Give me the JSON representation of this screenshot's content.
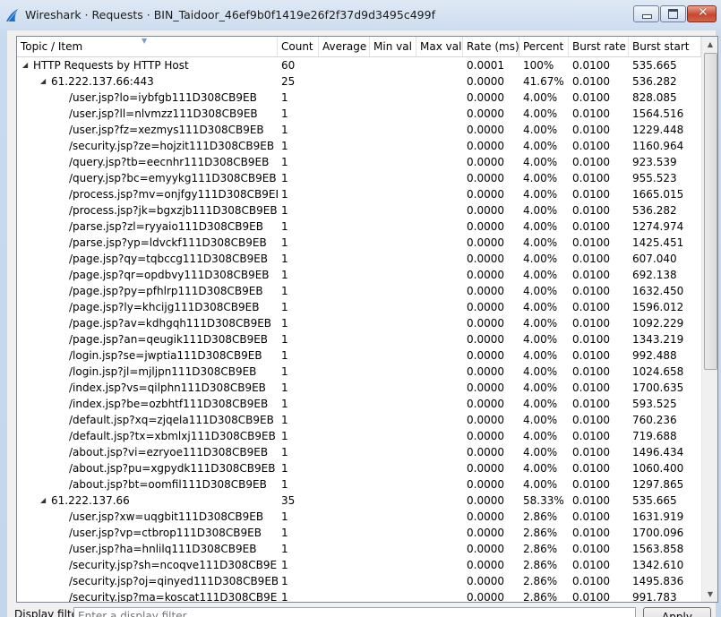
{
  "window": {
    "title": "Wireshark · Requests · BIN_Taidoor_46ef9b0f1419e26f2f37d9d3495c499f",
    "icon": "wireshark-fin-icon",
    "accent": "#1e6fc8"
  },
  "columns": [
    "Topic / Item",
    "Count",
    "Average",
    "Min val",
    "Max val",
    "Rate (ms)",
    "Percent",
    "Burst rate",
    "Burst start"
  ],
  "rows": [
    {
      "level": 0,
      "expanded": true,
      "topic": "HTTP Requests by HTTP Host",
      "count": "60",
      "rate": "0.0001",
      "percent": "100%",
      "burst_rate": "0.0100",
      "burst_start": "535.665"
    },
    {
      "level": 1,
      "expanded": true,
      "topic": "61.222.137.66:443",
      "count": "25",
      "rate": "0.0000",
      "percent": "41.67%",
      "burst_rate": "0.0100",
      "burst_start": "536.282"
    },
    {
      "level": 2,
      "topic": "/user.jsp?lo=iybfgb111D308CB9EB",
      "count": "1",
      "rate": "0.0000",
      "percent": "4.00%",
      "burst_rate": "0.0100",
      "burst_start": "828.085"
    },
    {
      "level": 2,
      "topic": "/user.jsp?ll=nlvmzz111D308CB9EB",
      "count": "1",
      "rate": "0.0000",
      "percent": "4.00%",
      "burst_rate": "0.0100",
      "burst_start": "1564.516"
    },
    {
      "level": 2,
      "topic": "/user.jsp?fz=xezmys111D308CB9EB",
      "count": "1",
      "rate": "0.0000",
      "percent": "4.00%",
      "burst_rate": "0.0100",
      "burst_start": "1229.448"
    },
    {
      "level": 2,
      "topic": "/security.jsp?ze=hojzit111D308CB9EB",
      "count": "1",
      "rate": "0.0000",
      "percent": "4.00%",
      "burst_rate": "0.0100",
      "burst_start": "1160.964"
    },
    {
      "level": 2,
      "topic": "/query.jsp?tb=eecnhr111D308CB9EB",
      "count": "1",
      "rate": "0.0000",
      "percent": "4.00%",
      "burst_rate": "0.0100",
      "burst_start": "923.539"
    },
    {
      "level": 2,
      "topic": "/query.jsp?bc=emyykg111D308CB9EB",
      "count": "1",
      "rate": "0.0000",
      "percent": "4.00%",
      "burst_rate": "0.0100",
      "burst_start": "955.523"
    },
    {
      "level": 2,
      "topic": "/process.jsp?mv=onjfgy111D308CB9EB",
      "count": "1",
      "rate": "0.0000",
      "percent": "4.00%",
      "burst_rate": "0.0100",
      "burst_start": "1665.015"
    },
    {
      "level": 2,
      "topic": "/process.jsp?jk=bgxzjb111D308CB9EB",
      "count": "1",
      "rate": "0.0000",
      "percent": "4.00%",
      "burst_rate": "0.0100",
      "burst_start": "536.282"
    },
    {
      "level": 2,
      "topic": "/parse.jsp?zl=ryyaio111D308CB9EB",
      "count": "1",
      "rate": "0.0000",
      "percent": "4.00%",
      "burst_rate": "0.0100",
      "burst_start": "1274.974"
    },
    {
      "level": 2,
      "topic": "/parse.jsp?yp=ldvckf111D308CB9EB",
      "count": "1",
      "rate": "0.0000",
      "percent": "4.00%",
      "burst_rate": "0.0100",
      "burst_start": "1425.451"
    },
    {
      "level": 2,
      "topic": "/page.jsp?qy=tqbccg111D308CB9EB",
      "count": "1",
      "rate": "0.0000",
      "percent": "4.00%",
      "burst_rate": "0.0100",
      "burst_start": "607.040"
    },
    {
      "level": 2,
      "topic": "/page.jsp?qr=opdbvy111D308CB9EB",
      "count": "1",
      "rate": "0.0000",
      "percent": "4.00%",
      "burst_rate": "0.0100",
      "burst_start": "692.138"
    },
    {
      "level": 2,
      "topic": "/page.jsp?py=pfhlrp111D308CB9EB",
      "count": "1",
      "rate": "0.0000",
      "percent": "4.00%",
      "burst_rate": "0.0100",
      "burst_start": "1632.450"
    },
    {
      "level": 2,
      "topic": "/page.jsp?ly=khcijg111D308CB9EB",
      "count": "1",
      "rate": "0.0000",
      "percent": "4.00%",
      "burst_rate": "0.0100",
      "burst_start": "1596.012"
    },
    {
      "level": 2,
      "topic": "/page.jsp?av=kdhgqh111D308CB9EB",
      "count": "1",
      "rate": "0.0000",
      "percent": "4.00%",
      "burst_rate": "0.0100",
      "burst_start": "1092.229"
    },
    {
      "level": 2,
      "topic": "/page.jsp?an=qeugik111D308CB9EB",
      "count": "1",
      "rate": "0.0000",
      "percent": "4.00%",
      "burst_rate": "0.0100",
      "burst_start": "1343.219"
    },
    {
      "level": 2,
      "topic": "/login.jsp?se=jwptia111D308CB9EB",
      "count": "1",
      "rate": "0.0000",
      "percent": "4.00%",
      "burst_rate": "0.0100",
      "burst_start": "992.488"
    },
    {
      "level": 2,
      "topic": "/login.jsp?jl=mjljpn111D308CB9EB",
      "count": "1",
      "rate": "0.0000",
      "percent": "4.00%",
      "burst_rate": "0.0100",
      "burst_start": "1024.658"
    },
    {
      "level": 2,
      "topic": "/index.jsp?vs=qilphn111D308CB9EB",
      "count": "1",
      "rate": "0.0000",
      "percent": "4.00%",
      "burst_rate": "0.0100",
      "burst_start": "1700.635"
    },
    {
      "level": 2,
      "topic": "/index.jsp?be=ozbhtf111D308CB9EB",
      "count": "1",
      "rate": "0.0000",
      "percent": "4.00%",
      "burst_rate": "0.0100",
      "burst_start": "593.525"
    },
    {
      "level": 2,
      "topic": "/default.jsp?xq=zjqela111D308CB9EB",
      "count": "1",
      "rate": "0.0000",
      "percent": "4.00%",
      "burst_rate": "0.0100",
      "burst_start": "760.236"
    },
    {
      "level": 2,
      "topic": "/default.jsp?tx=xbmlxj111D308CB9EB",
      "count": "1",
      "rate": "0.0000",
      "percent": "4.00%",
      "burst_rate": "0.0100",
      "burst_start": "719.688"
    },
    {
      "level": 2,
      "topic": "/about.jsp?vi=ezryoe111D308CB9EB",
      "count": "1",
      "rate": "0.0000",
      "percent": "4.00%",
      "burst_rate": "0.0100",
      "burst_start": "1496.434"
    },
    {
      "level": 2,
      "topic": "/about.jsp?pu=xgpydk111D308CB9EB",
      "count": "1",
      "rate": "0.0000",
      "percent": "4.00%",
      "burst_rate": "0.0100",
      "burst_start": "1060.400"
    },
    {
      "level": 2,
      "topic": "/about.jsp?bt=oomfil111D308CB9EB",
      "count": "1",
      "rate": "0.0000",
      "percent": "4.00%",
      "burst_rate": "0.0100",
      "burst_start": "1297.865"
    },
    {
      "level": 1,
      "expanded": true,
      "topic": "61.222.137.66",
      "count": "35",
      "rate": "0.0000",
      "percent": "58.33%",
      "burst_rate": "0.0100",
      "burst_start": "535.665"
    },
    {
      "level": 2,
      "topic": "/user.jsp?xw=uqgbit111D308CB9EB",
      "count": "1",
      "rate": "0.0000",
      "percent": "2.86%",
      "burst_rate": "0.0100",
      "burst_start": "1631.919"
    },
    {
      "level": 2,
      "topic": "/user.jsp?vp=ctbrop111D308CB9EB",
      "count": "1",
      "rate": "0.0000",
      "percent": "2.86%",
      "burst_rate": "0.0100",
      "burst_start": "1700.096"
    },
    {
      "level": 2,
      "topic": "/user.jsp?ha=hnlilq111D308CB9EB",
      "count": "1",
      "rate": "0.0000",
      "percent": "2.86%",
      "burst_rate": "0.0100",
      "burst_start": "1563.858"
    },
    {
      "level": 2,
      "topic": "/security.jsp?sh=ncoqve111D308CB9EB",
      "count": "1",
      "rate": "0.0000",
      "percent": "2.86%",
      "burst_rate": "0.0100",
      "burst_start": "1342.610"
    },
    {
      "level": 2,
      "topic": "/security.jsp?oj=qinyed111D308CB9EB",
      "count": "1",
      "rate": "0.0000",
      "percent": "2.86%",
      "burst_rate": "0.0100",
      "burst_start": "1495.836"
    },
    {
      "level": 2,
      "topic": "/security.jsp?ma=koscat111D308CB9EB",
      "count": "1",
      "rate": "0.0000",
      "percent": "2.86%",
      "burst_rate": "0.0100",
      "burst_start": "991.783"
    }
  ],
  "filter": {
    "label": "Display filter:",
    "placeholder": "Enter a display filter ...",
    "apply_label": "Apply"
  }
}
